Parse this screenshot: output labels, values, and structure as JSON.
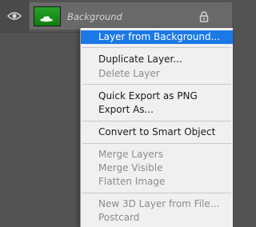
{
  "layers_panel": {
    "layer": {
      "name": "Background",
      "visible_icon": "eye-icon",
      "lock_icon": "lock-icon"
    }
  },
  "context_menu": {
    "items": [
      {
        "label": "Layer from Background...",
        "enabled": true,
        "highlighted": true
      },
      {
        "label": "Duplicate Layer...",
        "enabled": true
      },
      {
        "label": "Delete Layer",
        "enabled": false
      },
      {
        "label": "Quick Export as PNG",
        "enabled": true
      },
      {
        "label": "Export As...",
        "enabled": true
      },
      {
        "label": "Convert to Smart Object",
        "enabled": true
      },
      {
        "label": "Merge Layers",
        "enabled": false
      },
      {
        "label": "Merge Visible",
        "enabled": false
      },
      {
        "label": "Flatten Image",
        "enabled": false
      },
      {
        "label": "New 3D Layer from File...",
        "enabled": false
      },
      {
        "label": "Postcard",
        "enabled": false
      }
    ]
  },
  "colors": {
    "panel_bg": "#535353",
    "menu_bg": "#f0f0f0",
    "highlight": "#1a79e6",
    "disabled_text": "#8c8c8c"
  }
}
